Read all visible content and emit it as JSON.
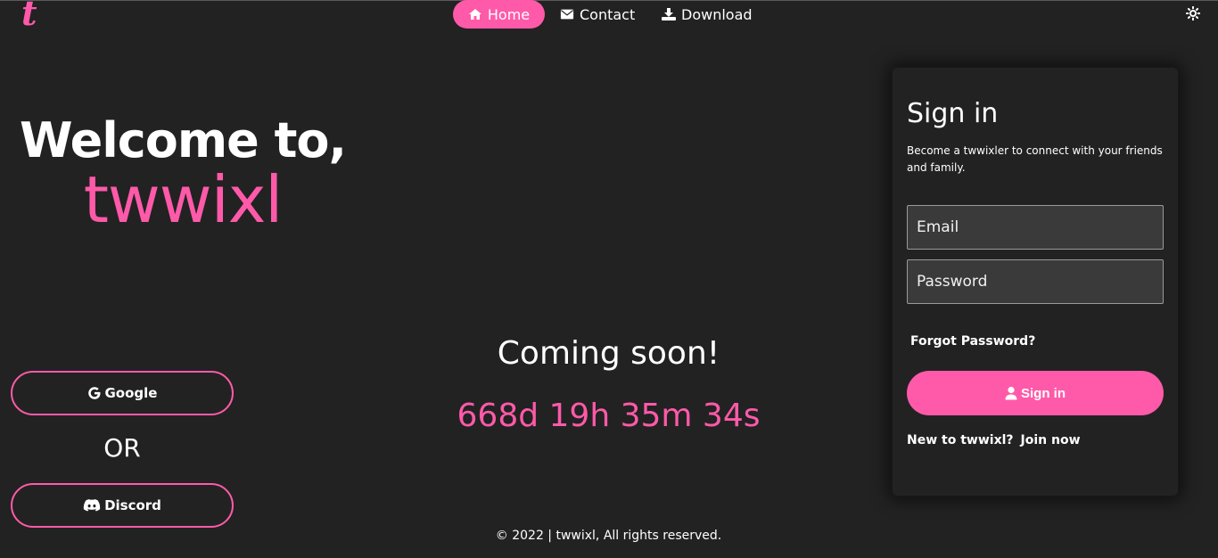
{
  "logo": {
    "letter": "t",
    "color": "#ff5aa9"
  },
  "nav": {
    "items": [
      {
        "label": "Home",
        "icon": "home-icon",
        "active": true
      },
      {
        "label": "Contact",
        "icon": "envelope-icon",
        "active": false
      },
      {
        "label": "Download",
        "icon": "download-icon",
        "active": false
      }
    ],
    "theme_toggle_icon": "sun-icon"
  },
  "hero": {
    "welcome": "Welcome to,",
    "brand": "twwixl"
  },
  "social": {
    "google_label": "Google",
    "or_label": "OR",
    "discord_label": "Discord"
  },
  "center": {
    "coming_soon": "Coming soon!",
    "countdown": "668d 19h 35m 34s"
  },
  "footer": {
    "text": "© 2022 | twwixl, All rights reserved."
  },
  "signin": {
    "title": "Sign in",
    "subtitle": "Become a twwixler to connect with your friends and family.",
    "email_placeholder": "Email",
    "password_placeholder": "Password",
    "forgot_label": "Forgot Password?",
    "button_label": "Sign in",
    "new_label": "New to twwixl?",
    "join_label": "Join now"
  },
  "colors": {
    "accent": "#ff5aa9",
    "background": "#222222",
    "field_bg": "#3a3a3a"
  }
}
